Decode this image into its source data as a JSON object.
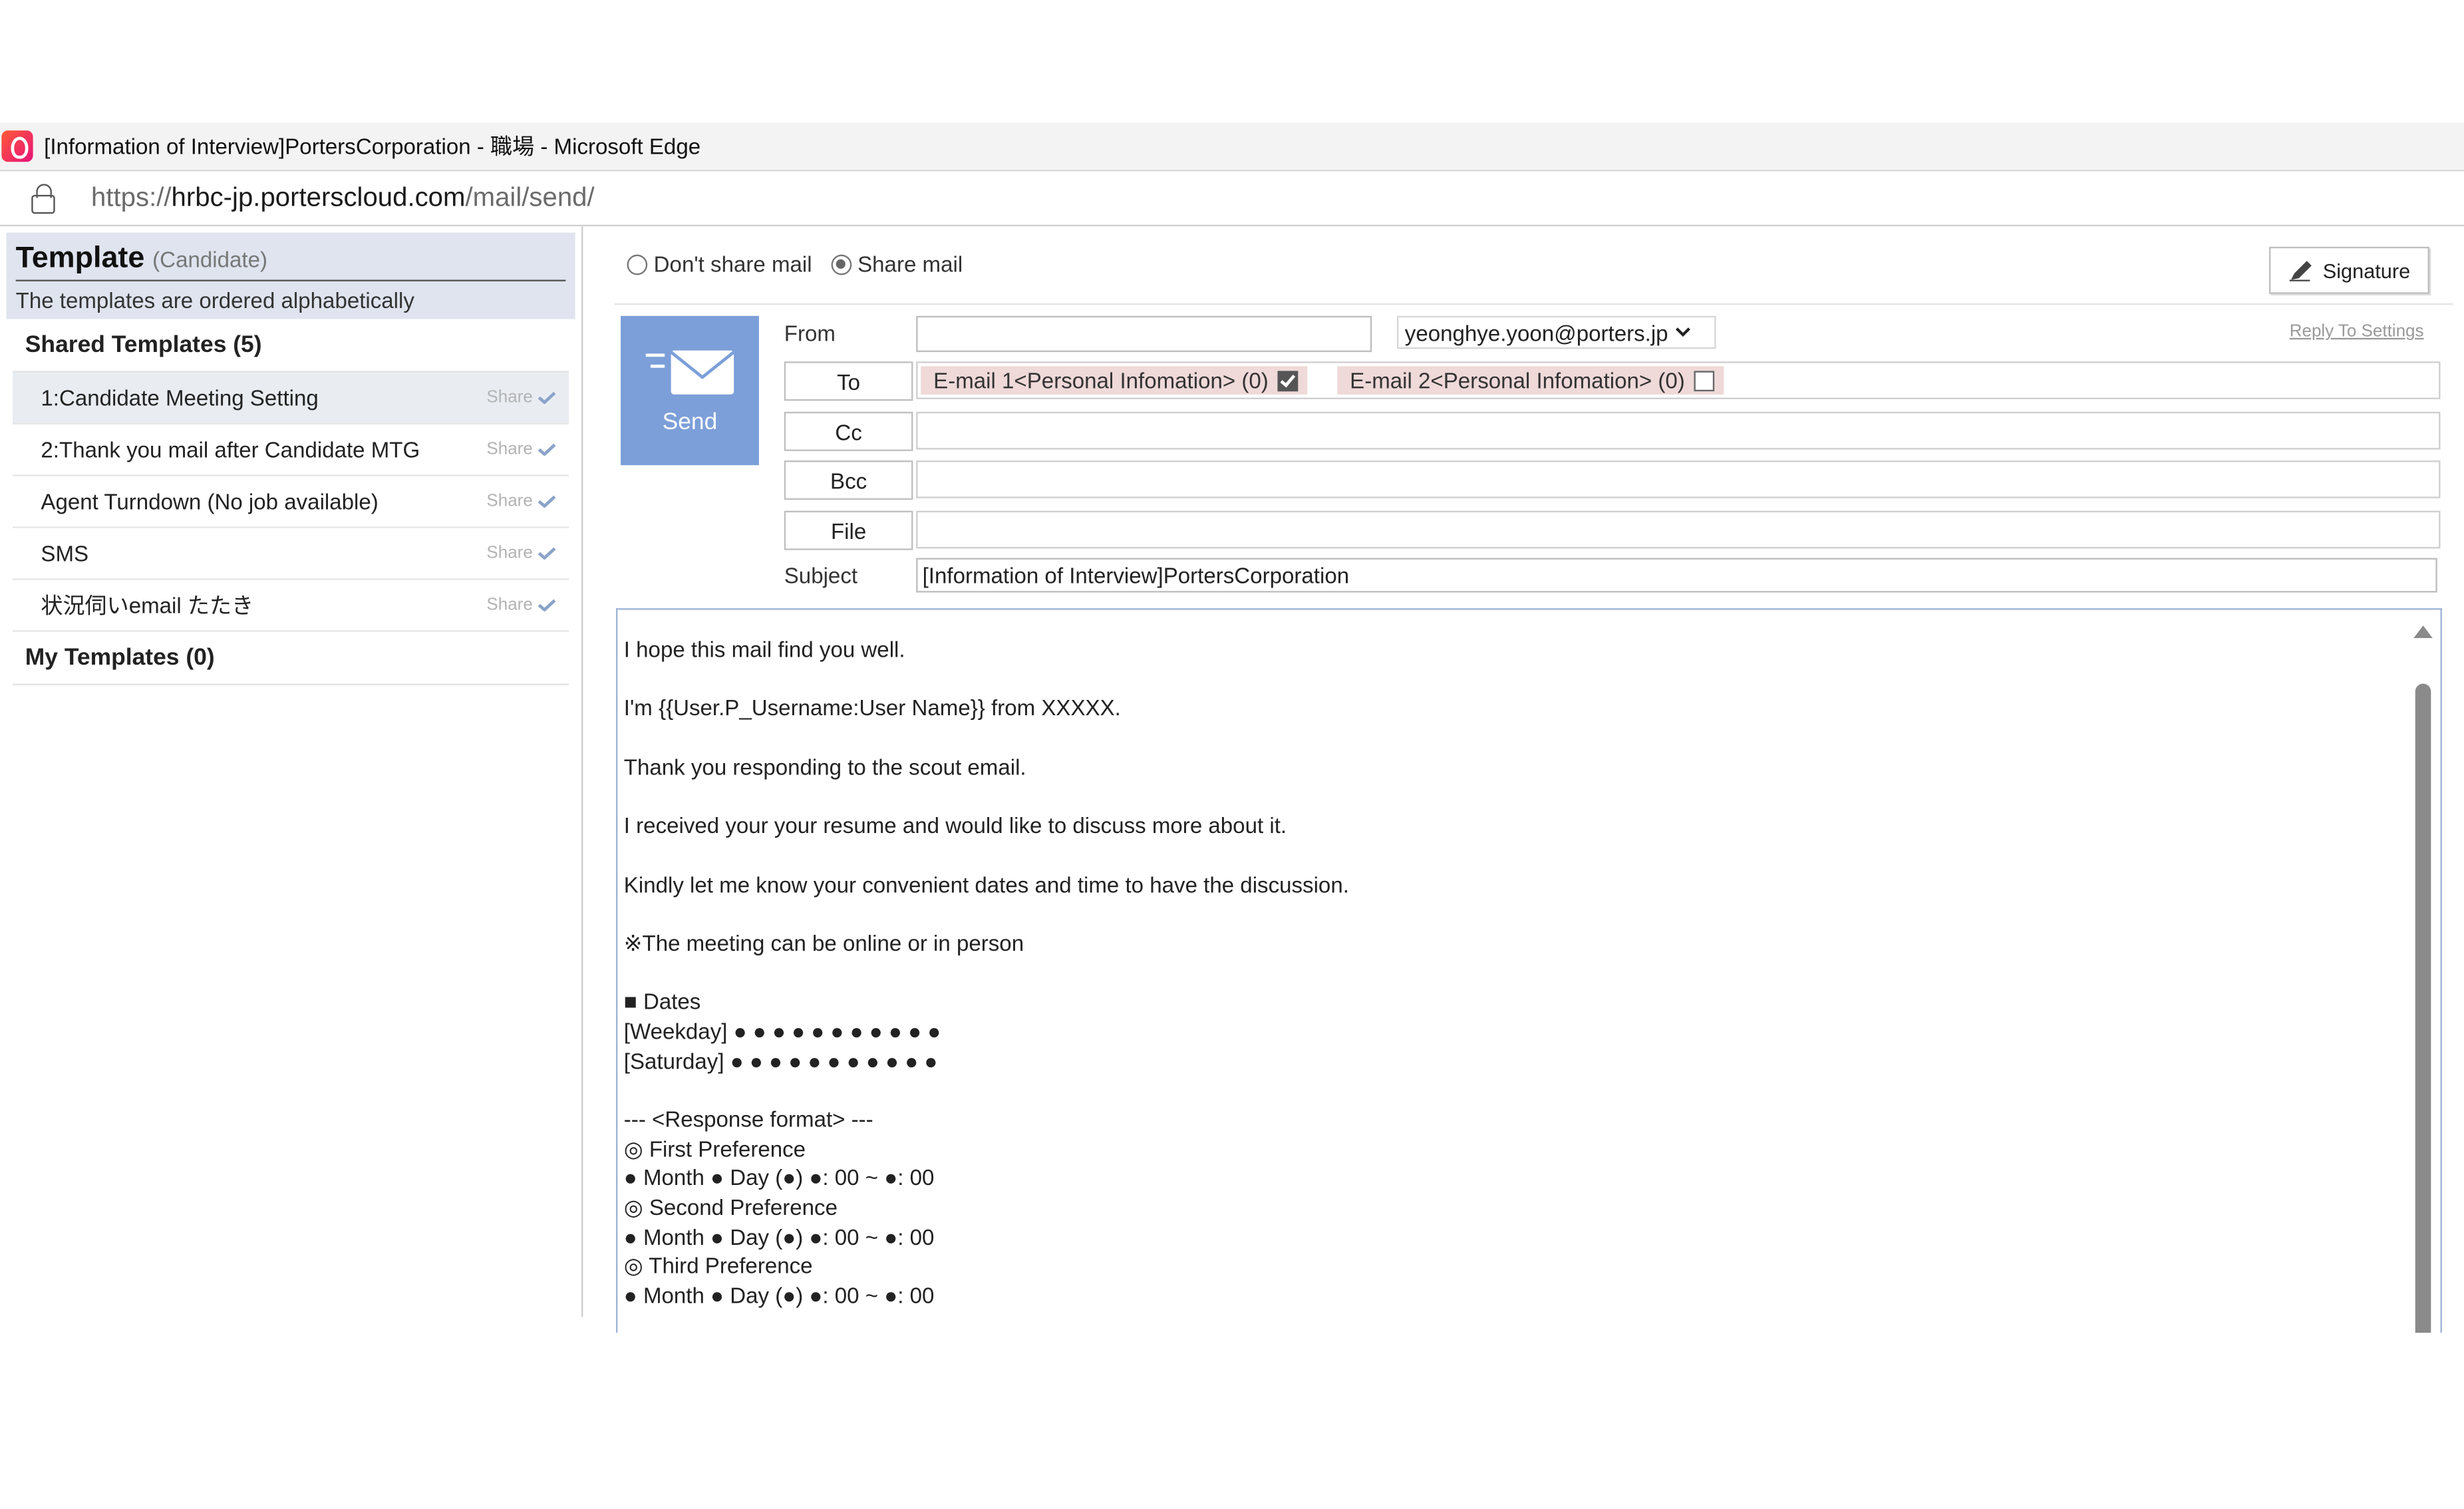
{
  "browser": {
    "window_title": "[Information of Interview]PortersCorporation - 職場 - Microsoft Edge",
    "url_scheme": "https://",
    "url_host": "hrbc-jp.porterscloud.com",
    "url_path": "/mail/send/"
  },
  "templates": {
    "title": "Template",
    "subtitle": "(Candidate)",
    "note": "The templates are ordered alphabetically",
    "shared_heading": "Shared Templates (5)",
    "shared_items": [
      {
        "label": "1:Candidate Meeting Setting",
        "tag": "Share"
      },
      {
        "label": "2:Thank you mail after Candidate MTG",
        "tag": "Share"
      },
      {
        "label": "Agent Turndown (No job available)",
        "tag": "Share"
      },
      {
        "label": "SMS",
        "tag": "Share"
      },
      {
        "label": "状況伺いemail たたき",
        "tag": "Share"
      }
    ],
    "my_heading": "My Templates (0)"
  },
  "compose": {
    "share_options": [
      "Don't share mail",
      "Share mail"
    ],
    "share_selected": "Share mail",
    "signature_label": "Signature",
    "send_label": "Send",
    "from_label": "From",
    "from_value": "",
    "from_account": "yeonghye.yoon@porters.jp",
    "reply_settings_label": "Reply To Settings",
    "to_label": "To",
    "cc_label": "Cc",
    "bcc_label": "Bcc",
    "file_label": "File",
    "subject_label": "Subject",
    "to_chips": [
      {
        "label": "E-mail 1<Personal Infomation> (0)",
        "checked": true
      },
      {
        "label": "E-mail 2<Personal Infomation> (0)",
        "checked": false
      }
    ],
    "subject_value": "[Information of Interview]PortersCorporation",
    "body_lines": [
      "I hope this mail find you well.",
      "",
      "I'm {{User.P_Username:User Name}} from XXXXX.",
      "",
      "Thank you responding to the scout email.",
      "",
      "I received your your resume and would like to discuss more about it.",
      "",
      "Kindly let me know your convenient dates and time to have the discussion.",
      "",
      "※The meeting can be online or in person",
      "",
      "■ Dates",
      "[Weekday] ● ● ● ● ● ● ● ● ● ● ●",
      "[Saturday] ● ● ● ● ● ● ● ● ● ● ●",
      "",
      "--- <Response format> ---",
      "◎ First Preference",
      "● Month ● Day (●) ●: 00 ~ ●: 00",
      "◎ Second Preference",
      "● Month ● Day (●) ●: 00 ~ ●: 00",
      "◎ Third Preference",
      "● Month ● Day (●) ●: 00 ~ ●: 00"
    ]
  },
  "colors": {
    "send_button": "#7c9fd9",
    "template_header_bg": "#dfe4ef",
    "chip_bg": "#efd9d9",
    "selected_row": "#e9edf2"
  }
}
